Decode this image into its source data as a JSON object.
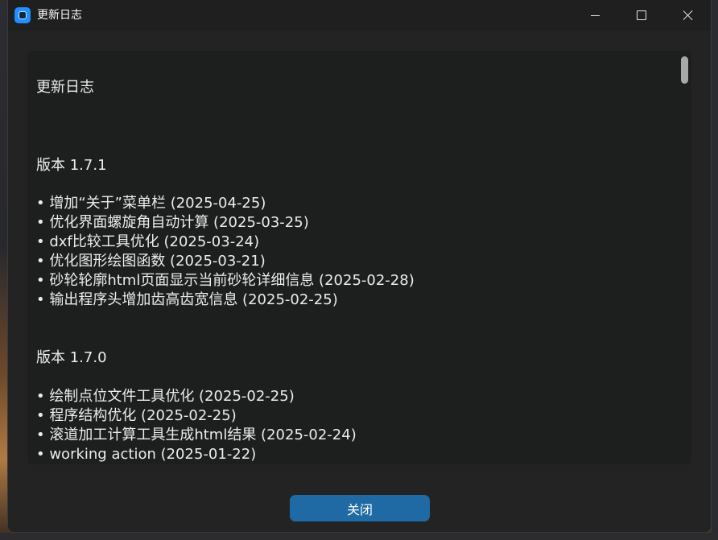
{
  "window": {
    "title": "更新日志"
  },
  "changelog": {
    "heading": "更新日志",
    "versions": [
      {
        "label": "版本 1.7.1",
        "items": [
          "• 增加“关于”菜单栏 (2025-04-25)",
          "• 优化界面螺旋角自动计算 (2025-03-25)",
          "• dxf比较工具优化 (2025-03-24)",
          "• 优化图形绘图函数 (2025-03-21)",
          "• 砂轮轮廓html页面显示当前砂轮详细信息 (2025-02-28)",
          "• 输出程序头增加齿高齿宽信息 (2025-02-25)"
        ]
      },
      {
        "label": "版本 1.7.0",
        "items": [
          "• 绘制点位文件工具优化 (2025-02-25)",
          "• 程序结构优化 (2025-02-25)",
          "• 滚道加工计算工具生成html结果 (2025-02-24)",
          "• working action (2025-01-22)"
        ]
      }
    ]
  },
  "footer": {
    "close_label": "关闭"
  },
  "colors": {
    "accent": "#1f6aa5",
    "background": "#232323",
    "panel": "#1d1e1e",
    "text": "#ececec"
  }
}
